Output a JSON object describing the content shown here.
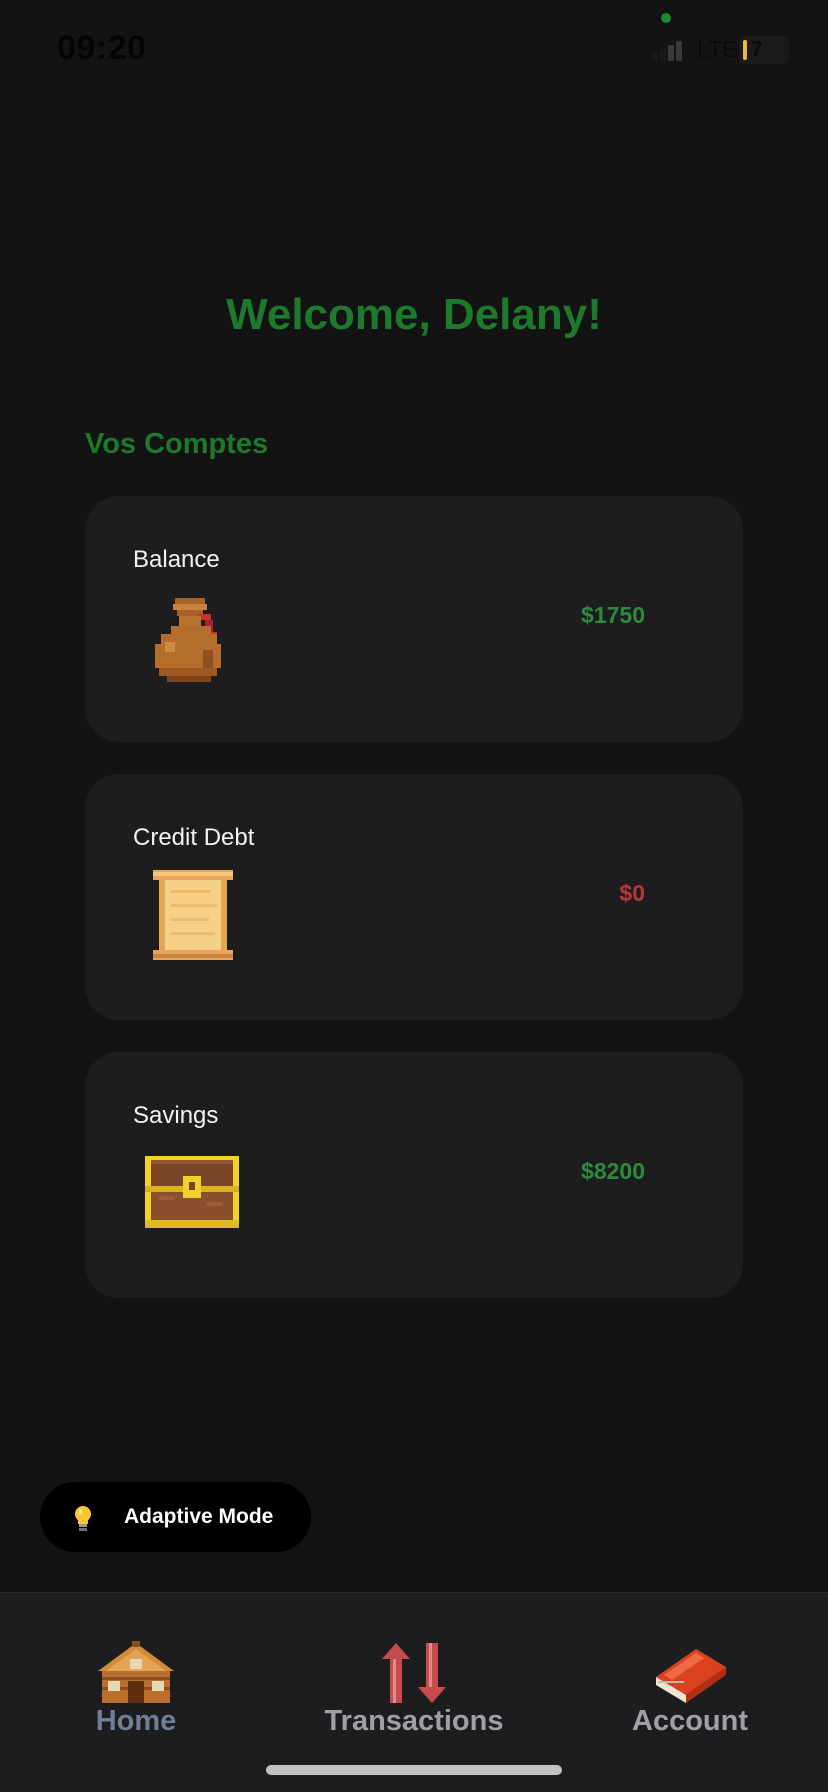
{
  "status_bar": {
    "time": "09:20",
    "network": "LTE",
    "battery": "7"
  },
  "header": {
    "welcome": "Welcome, Delany!"
  },
  "accounts": {
    "section_title": "Vos Comptes",
    "items": [
      {
        "label": "Balance",
        "value": "$1750",
        "icon": "money-bag-icon",
        "value_color": "#2e8b3e"
      },
      {
        "label": "Credit Debt",
        "value": "$0",
        "icon": "scroll-icon",
        "value_color": "#b8383a"
      },
      {
        "label": "Savings",
        "value": "$8200",
        "icon": "treasure-chest-icon",
        "value_color": "#2e8b3e"
      }
    ]
  },
  "adaptive_mode": {
    "label": "Adaptive Mode",
    "icon": "lightbulb-icon"
  },
  "tab_bar": {
    "tabs": [
      {
        "label": "Home",
        "icon": "house-icon",
        "active": true
      },
      {
        "label": "Transactions",
        "icon": "up-down-arrows-icon",
        "active": false
      },
      {
        "label": "Account",
        "icon": "book-icon",
        "active": false
      }
    ]
  },
  "colors": {
    "background": "#131313",
    "card": "#1d1d1f",
    "accent_green": "#1d7a2c",
    "positive_value": "#2e8b3e",
    "negative_value": "#b8383a",
    "tab_active": "#6e7f98",
    "tab_inactive": "#a0a0a4"
  }
}
